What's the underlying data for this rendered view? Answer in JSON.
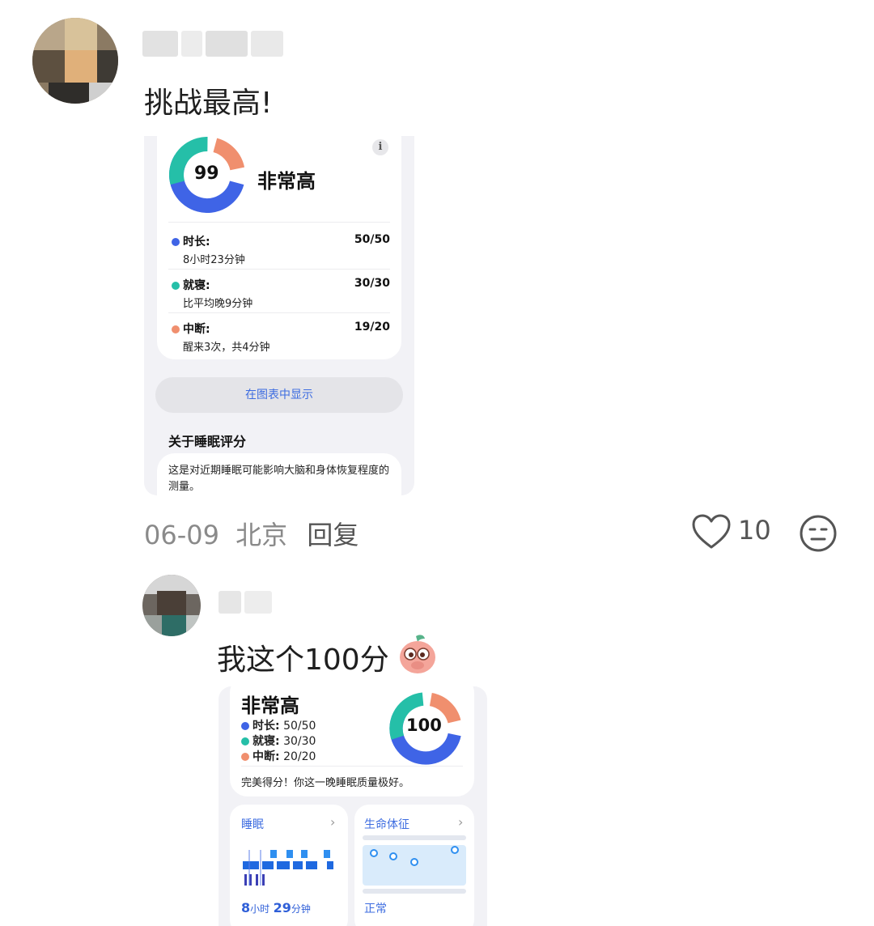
{
  "comments": [
    {
      "text": "挑战最高!",
      "date": "06-09",
      "location": "北京",
      "reply_label": "回复",
      "likes": "10",
      "screenshot": {
        "score": "99",
        "rating": "非常高",
        "info_icon": "i",
        "rows": [
          {
            "label": "时长:",
            "detail": "8小时23分钟",
            "score": "50/50",
            "color": "#3f64e6"
          },
          {
            "label": "就寝:",
            "detail": "比平均晚9分钟",
            "score": "30/30",
            "color": "#25bfa8"
          },
          {
            "label": "中断:",
            "detail": "醒来3次，共4分钟",
            "score": "19/20",
            "color": "#f08f6e"
          }
        ],
        "chart_button": "在图表中显示",
        "about_title": "关于睡眠评分",
        "about_text": "这是对近期睡眠可能影响大脑和身体恢复程度的测量。"
      }
    },
    {
      "text": "我这个100分",
      "screenshot": {
        "rating": "非常高",
        "score": "100",
        "legend": [
          {
            "label": "时长:",
            "value": "50/50",
            "color": "#3f64e6"
          },
          {
            "label": "就寝:",
            "value": "30/30",
            "color": "#25bfa8"
          },
          {
            "label": "中断:",
            "value": "20/20",
            "color": "#f08f6e"
          }
        ],
        "summary": "完美得分！你这一晚睡眠质量极好。",
        "sleep_card": {
          "title": "睡眠",
          "num1": "8",
          "unit1": "小时",
          "num2": "29",
          "unit2": "分钟"
        },
        "vitals_card": {
          "title": "生命体征",
          "status": "正常"
        }
      }
    }
  ],
  "icons": [
    "heart-icon",
    "meh-face-icon",
    "info-icon",
    "chevron-right-icon",
    "peach-emoji-icon"
  ]
}
